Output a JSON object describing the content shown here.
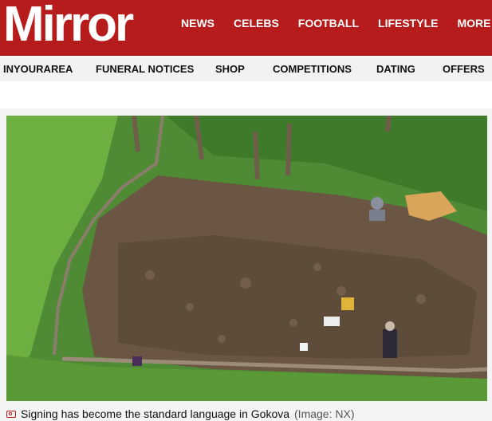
{
  "brand": {
    "logo_text": "Mirror",
    "accent": "#b71c1c"
  },
  "main_nav": {
    "items": [
      {
        "label": "NEWS"
      },
      {
        "label": "CELEBS"
      },
      {
        "label": "FOOTBALL"
      },
      {
        "label": "LIFESTYLE"
      }
    ],
    "more_label": "MORE",
    "more_icon": "chevron-down-icon"
  },
  "sub_nav": {
    "items": [
      {
        "label": "INYOURAREA"
      },
      {
        "label": "FUNERAL NOTICES"
      },
      {
        "label": "SHOP"
      },
      {
        "label": "COMPETITIONS"
      },
      {
        "label": "DATING"
      },
      {
        "label": "OFFERS"
      }
    ]
  },
  "article": {
    "image_caption": "Signing has become the standard language in Gokova",
    "image_credit": "(Image: NX)",
    "caption_icon": "camera-icon"
  }
}
